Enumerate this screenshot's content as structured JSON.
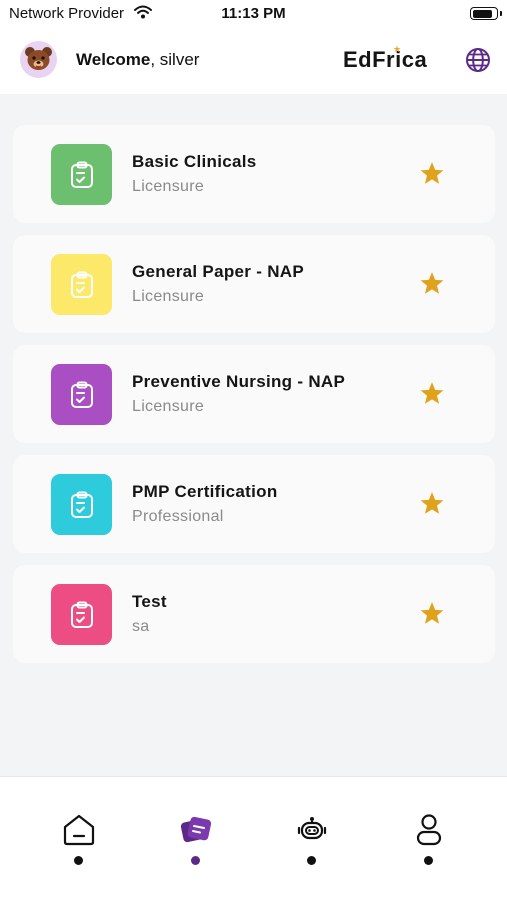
{
  "status_bar": {
    "carrier": "Network Provider",
    "time": "11:13 PM",
    "battery_level": 0.9
  },
  "header": {
    "welcome_text": "Welcome",
    "username": ", silver",
    "logo_text": "EdFrica",
    "logo_star": "★",
    "globe_icon": "globe-icon"
  },
  "courses": [
    {
      "title": "Basic Clinicals",
      "subtitle": "Licensure",
      "color": "#6cbf6f",
      "icon": "clipboard-check-icon",
      "favorite": true
    },
    {
      "title": "General Paper - NAP",
      "subtitle": "Licensure",
      "color": "#fce96a",
      "icon": "clipboard-check-icon",
      "favorite": true
    },
    {
      "title": "Preventive Nursing - NAP",
      "subtitle": "Licensure",
      "color": "#a94fc3",
      "icon": "clipboard-check-icon",
      "favorite": true
    },
    {
      "title": "PMP Certification",
      "subtitle": "Professional",
      "color": "#2ecbdc",
      "icon": "clipboard-check-icon",
      "favorite": true
    },
    {
      "title": "Test",
      "subtitle": "sa",
      "color": "#ec4d83",
      "icon": "clipboard-check-icon",
      "favorite": true
    }
  ],
  "colors": {
    "star": "#e0a21b",
    "accent": "#5b2a86",
    "background": "#f3f4f6"
  },
  "bottom_nav": [
    {
      "icon": "home-icon",
      "active": false
    },
    {
      "icon": "courses-icon",
      "active": true
    },
    {
      "icon": "robot-icon",
      "active": false
    },
    {
      "icon": "profile-icon",
      "active": false
    }
  ]
}
